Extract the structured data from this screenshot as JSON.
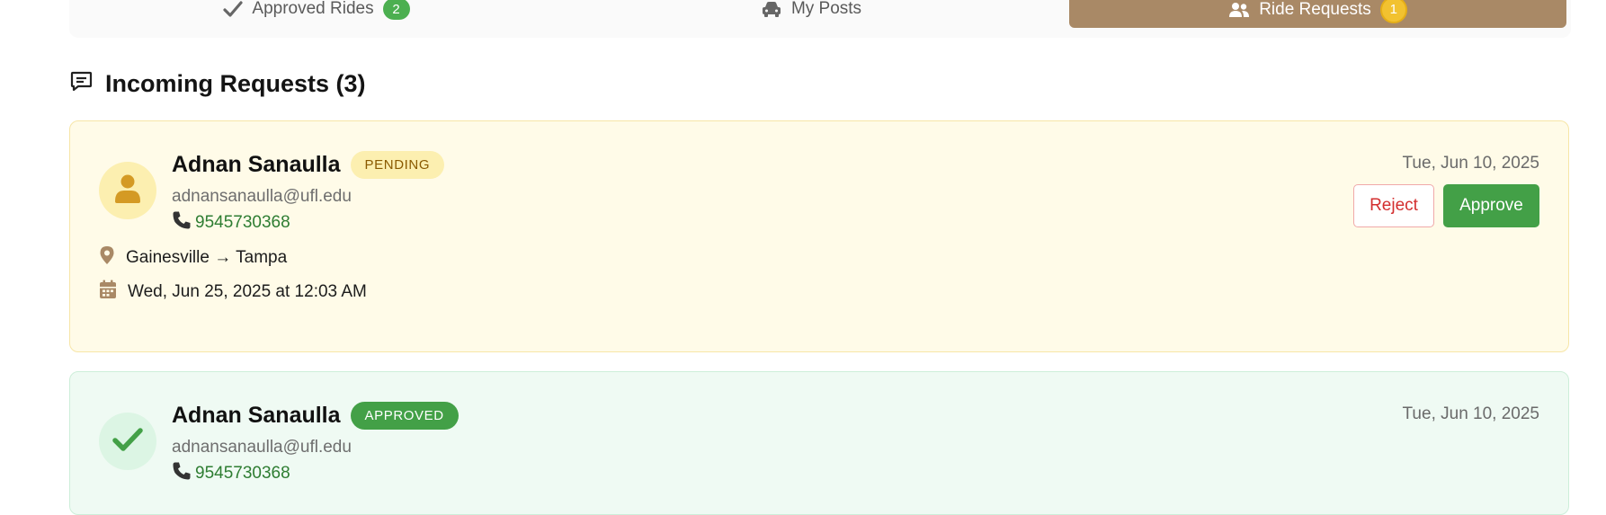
{
  "tabs": [
    {
      "label": "Approved Rides",
      "icon": "check-icon",
      "count": "2"
    },
    {
      "label": "My Posts",
      "icon": "car-icon"
    },
    {
      "label": "Ride Requests",
      "icon": "users-icon",
      "count": "1",
      "active": true
    }
  ],
  "section": {
    "title": "Incoming Requests (3)",
    "icon": "message-icon"
  },
  "requests": [
    {
      "name": "Adnan Sanaulla",
      "status": "PENDING",
      "email": "adnansanaulla@ufl.edu",
      "phone": "9545730368",
      "request_date": "Tue, Jun 10, 2025",
      "route": "Gainesville → Tampa",
      "ride_datetime": "Wed, Jun 25, 2025 at 12:03 AM",
      "reject_label": "Reject",
      "approve_label": "Approve"
    },
    {
      "name": "Adnan Sanaulla",
      "status": "APPROVED",
      "email": "adnansanaulla@ufl.edu",
      "phone": "9545730368",
      "request_date": "Tue, Jun 10, 2025"
    }
  ],
  "colors": {
    "accent_brown": "#a98966",
    "approve_green": "#43a047",
    "reject_red": "#d32f2f",
    "pending_bg": "#fffbe8",
    "approved_bg": "#effaf3"
  }
}
